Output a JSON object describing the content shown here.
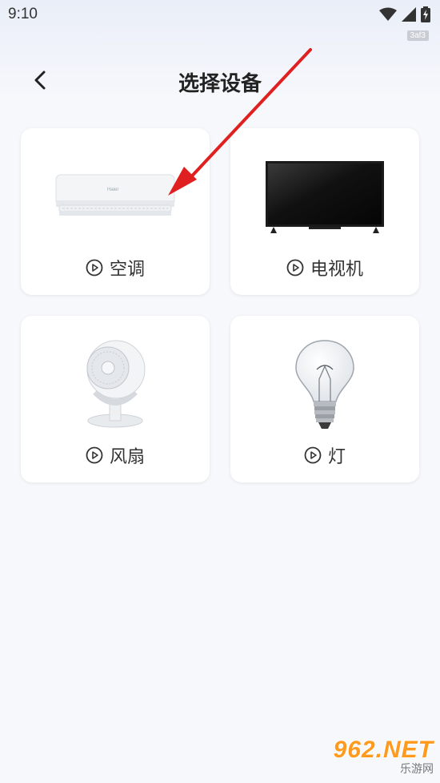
{
  "status_bar": {
    "time": "9:10",
    "tag": "3af3",
    "icons": [
      "wifi-icon",
      "cellular-signal-icon",
      "battery-charging-icon"
    ]
  },
  "header": {
    "back_icon": "chevron-left-icon",
    "title": "选择设备"
  },
  "devices": [
    {
      "label": "空调",
      "image": "air-conditioner-image",
      "icon": "play-circle-icon"
    },
    {
      "label": "电视机",
      "image": "television-image",
      "icon": "play-circle-icon"
    },
    {
      "label": "风扇",
      "image": "fan-image",
      "icon": "play-circle-icon"
    },
    {
      "label": "灯",
      "image": "light-bulb-image",
      "icon": "play-circle-icon"
    }
  ],
  "watermark": {
    "main": "962.NET",
    "sub": "乐游网"
  },
  "colors": {
    "background": "#f7f8fc",
    "card": "#ffffff",
    "annotation_arrow": "#e02020",
    "watermark": "#ff9a1e"
  }
}
